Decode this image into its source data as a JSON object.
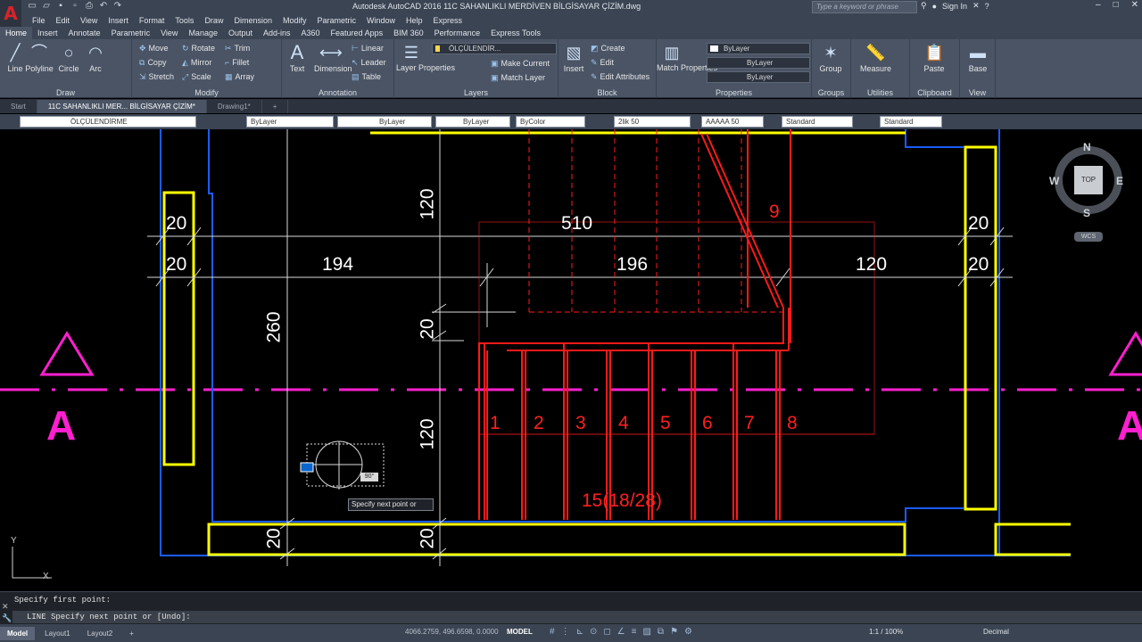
{
  "titlebar": {
    "app_title": "Autodesk AutoCAD 2016    11C SAHANLIKLI MERDİVEN BİLGİSAYAR ÇİZİM.dwg",
    "search_placeholder": "Type a keyword or phrase",
    "sign_in": "Sign In"
  },
  "menubar": [
    "File",
    "Edit",
    "View",
    "Insert",
    "Format",
    "Tools",
    "Draw",
    "Dimension",
    "Modify",
    "Parametric",
    "Window",
    "Help",
    "Express"
  ],
  "ribbon_tabs": [
    "Home",
    "Insert",
    "Annotate",
    "Parametric",
    "View",
    "Manage",
    "Output",
    "Add-ins",
    "A360",
    "Featured Apps",
    "BIM 360",
    "Performance",
    "Express Tools"
  ],
  "ribbon": {
    "draw": {
      "title": "Draw",
      "line": "Line",
      "polyline": "Polyline",
      "circle": "Circle",
      "arc": "Arc"
    },
    "modify": {
      "title": "Modify",
      "move": "Move",
      "rotate": "Rotate",
      "trim": "Trim",
      "copy": "Copy",
      "mirror": "Mirror",
      "fillet": "Fillet",
      "stretch": "Stretch",
      "scale": "Scale",
      "array": "Array"
    },
    "annotation": {
      "title": "Annotation",
      "text": "Text",
      "dimension": "Dimension",
      "linear": "Linear",
      "leader": "Leader",
      "table": "Table"
    },
    "layers": {
      "title": "Layers",
      "layer_properties": "Layer Properties",
      "current_layer": "ÖLÇÜLENDİR...",
      "make_current": "Make Current",
      "match_layer": "Match Layer"
    },
    "block": {
      "title": "Block",
      "insert": "Insert",
      "create": "Create",
      "edit": "Edit",
      "edit_attributes": "Edit Attributes"
    },
    "properties": {
      "title": "Properties",
      "match_properties": "Match Properties",
      "color": "ByLayer",
      "linetype": "ByLayer",
      "lineweight": "ByLayer"
    },
    "groups": {
      "title": "Groups",
      "group": "Group"
    },
    "utilities": {
      "title": "Utilities",
      "measure": "Measure"
    },
    "clipboard": {
      "title": "Clipboard",
      "paste": "Paste"
    },
    "view": {
      "title": "View",
      "base": "Base"
    }
  },
  "file_tabs": [
    "Start",
    "11C SAHANLIKLI MER... BİLGİSAYAR ÇİZİM*",
    "Drawing1*"
  ],
  "props_bar": {
    "layer": "ÖLÇÜLENDİRME",
    "color": "ByLayer",
    "linetype": "ByLayer",
    "lineweight": "ByLayer",
    "plotstyle": "ByColor",
    "dimstyle": "2lik 50",
    "textstyle": "AAAAA 50",
    "tablestyle": "Standard",
    "mleaderstyle": "Standard"
  },
  "drawing": {
    "dims": {
      "d510": "510",
      "d194": "194",
      "d196": "196",
      "d120_h": "120",
      "d20_tl1": "20",
      "d20_tl2": "20",
      "d20_tr1": "20",
      "d20_tr2": "20",
      "d120_v_top": "120",
      "d260": "260",
      "d20_v_mid": "20",
      "d120_v_bot": "120",
      "d20_bot1": "20",
      "d20_bot2": "20"
    },
    "steps": [
      "1",
      "2",
      "3",
      "4",
      "5",
      "6",
      "7",
      "8"
    ],
    "step_9": "9",
    "stair_label": "15(18/28)",
    "section_left": "A",
    "section_right": "A"
  },
  "viewcube": {
    "n": "N",
    "s": "S",
    "e": "E",
    "w": "W",
    "face": "TOP",
    "wcs": "WCS"
  },
  "cursor": {
    "tooltip": "Specify next point or",
    "angle": "90°"
  },
  "ucs": {
    "x": "X",
    "y": "Y"
  },
  "command": {
    "history": "Specify first point:",
    "prompt": "LINE Specify next point or [Undo]:"
  },
  "status": {
    "layout_tabs": [
      "Model",
      "Layout1",
      "Layout2"
    ],
    "coords": "4066.2759, 496.6598, 0.0000",
    "mode": "MODEL",
    "scale": "1:1 / 100%",
    "units": "Decimal"
  },
  "colors": {
    "wall_yellow": "#ffff00",
    "wall_blue": "#1a5cff",
    "stair_red": "#ff1a1a",
    "section_magenta": "#ff1fd0",
    "dim_white": "#ffffff"
  }
}
